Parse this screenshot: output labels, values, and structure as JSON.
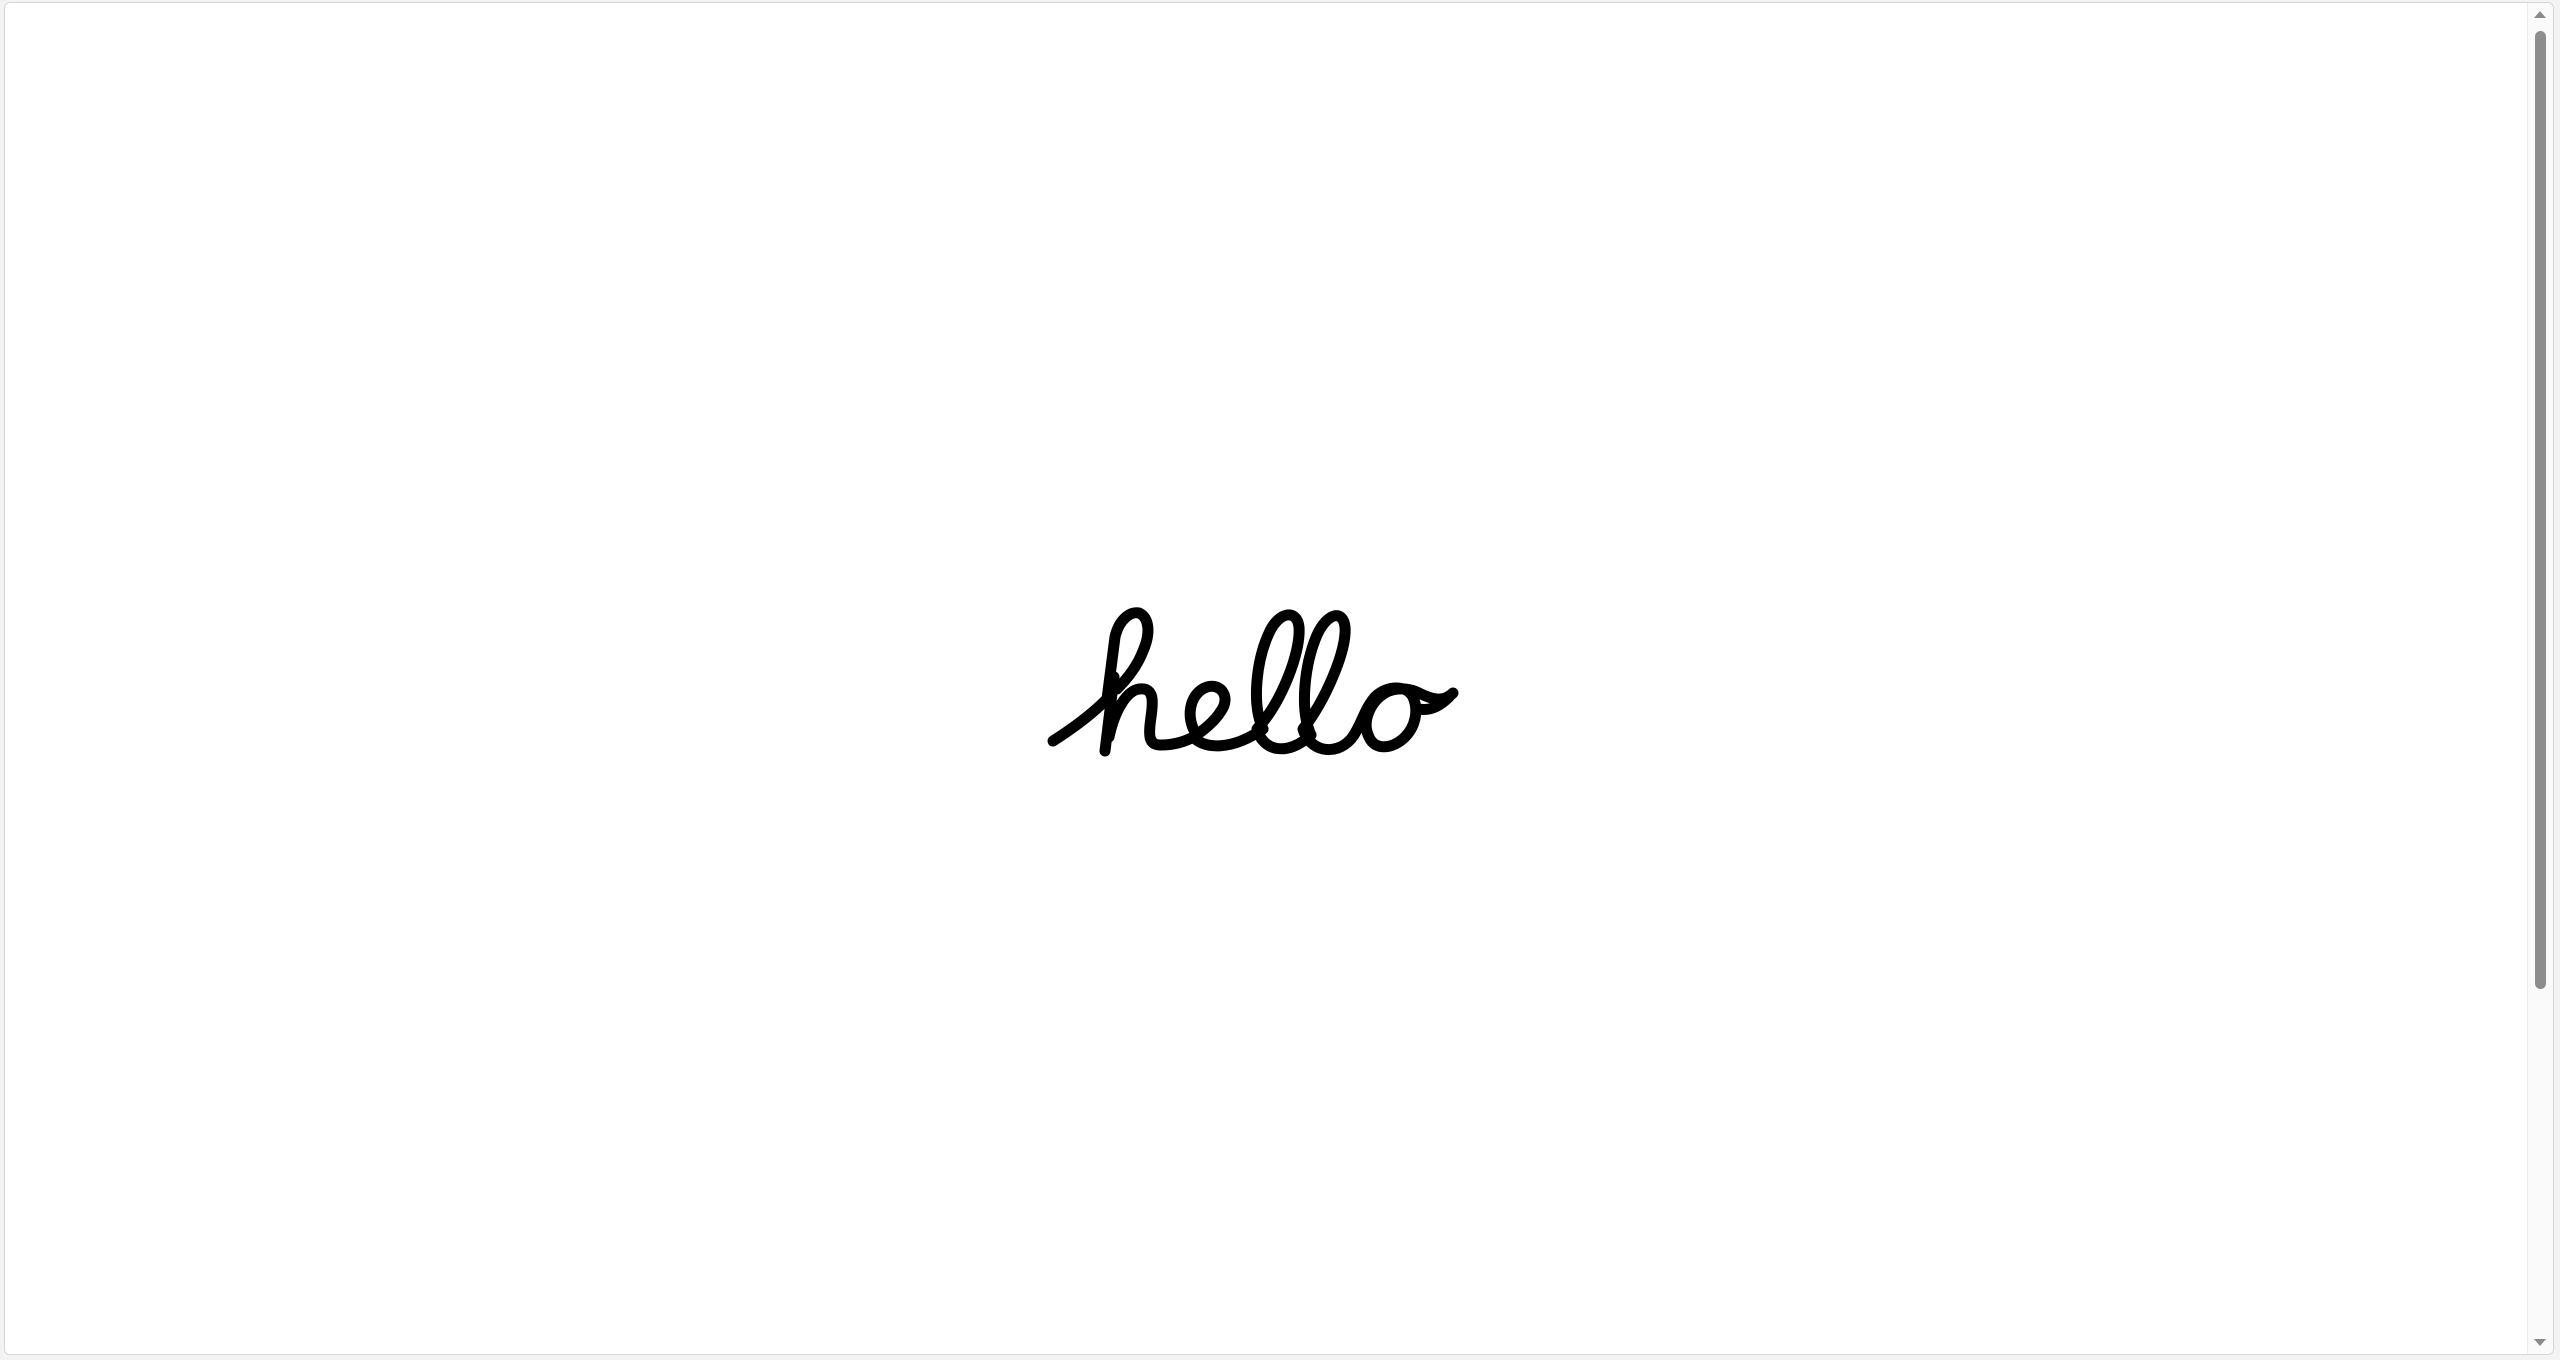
{
  "greeting": {
    "text": "hello",
    "stroke_color": "#000000"
  },
  "scrollbar": {
    "thumb_color": "#8d8d8d",
    "up_icon": "scroll-up-arrow",
    "down_icon": "scroll-down-arrow"
  }
}
